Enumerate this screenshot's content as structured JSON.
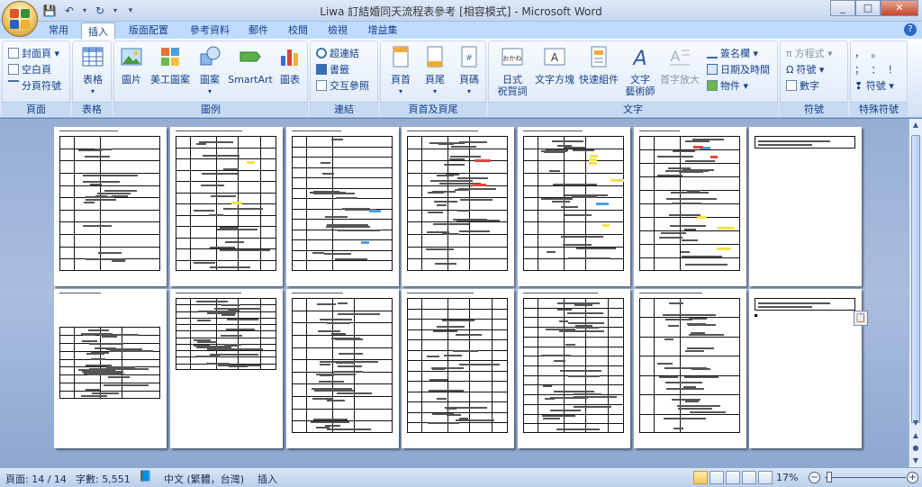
{
  "window": {
    "title": "Liwa 訂結婚同天流程表參考 [相容模式] - Microsoft Word",
    "controls": {
      "minimize": "_",
      "maximize": "□",
      "close": "✕"
    }
  },
  "qat": {
    "save": "💾",
    "undo": "↶",
    "redo": "↻",
    "more": "▾"
  },
  "tabs": [
    "常用",
    "插入",
    "版面配置",
    "參考資料",
    "郵件",
    "校閱",
    "檢視",
    "增益集"
  ],
  "active_tab": "插入",
  "ribbon": {
    "pages": {
      "cover": "封面頁",
      "blank": "空白頁",
      "page_break": "分頁符號",
      "label": "頁面"
    },
    "tables": {
      "table": "表格",
      "label": "表格"
    },
    "illustrations": {
      "picture": "圖片",
      "clipart": "美工圖案",
      "shapes": "圖案",
      "smartart": "SmartArt",
      "chart": "圖表",
      "label": "圖例"
    },
    "links": {
      "hyperlink": "超連結",
      "bookmark": "書籤",
      "crossref": "交互參照",
      "label": "連結"
    },
    "header_footer": {
      "header": "頁首",
      "footer": "頁尾",
      "page_number": "頁碼",
      "label": "頁首及頁尾"
    },
    "text": {
      "japanese_greeting": "日式",
      "japanese_greeting2": "祝賀詞",
      "textbox": "文字方塊",
      "quickparts": "快速組件",
      "wordart": "文字",
      "wordart2": "藝術師",
      "dropcap": "首字放大",
      "signature": "簽名欄",
      "datetime": "日期及時間",
      "object": "物件",
      "label": "文字"
    },
    "symbols": {
      "equation": "方程式",
      "symbol": "符號",
      "number": "數字",
      "label": "符號"
    },
    "special": {
      "row1": "，  。",
      "row2": "；  ：  ！",
      "more": "符號",
      "label": "特殊符號"
    }
  },
  "status": {
    "page": "頁面: 14 / 14",
    "words": "字數: 5,551",
    "language": "中文 (繁體，台灣)",
    "mode": "插入",
    "zoom": "17%"
  },
  "icons": {
    "clipboard": "📋"
  }
}
